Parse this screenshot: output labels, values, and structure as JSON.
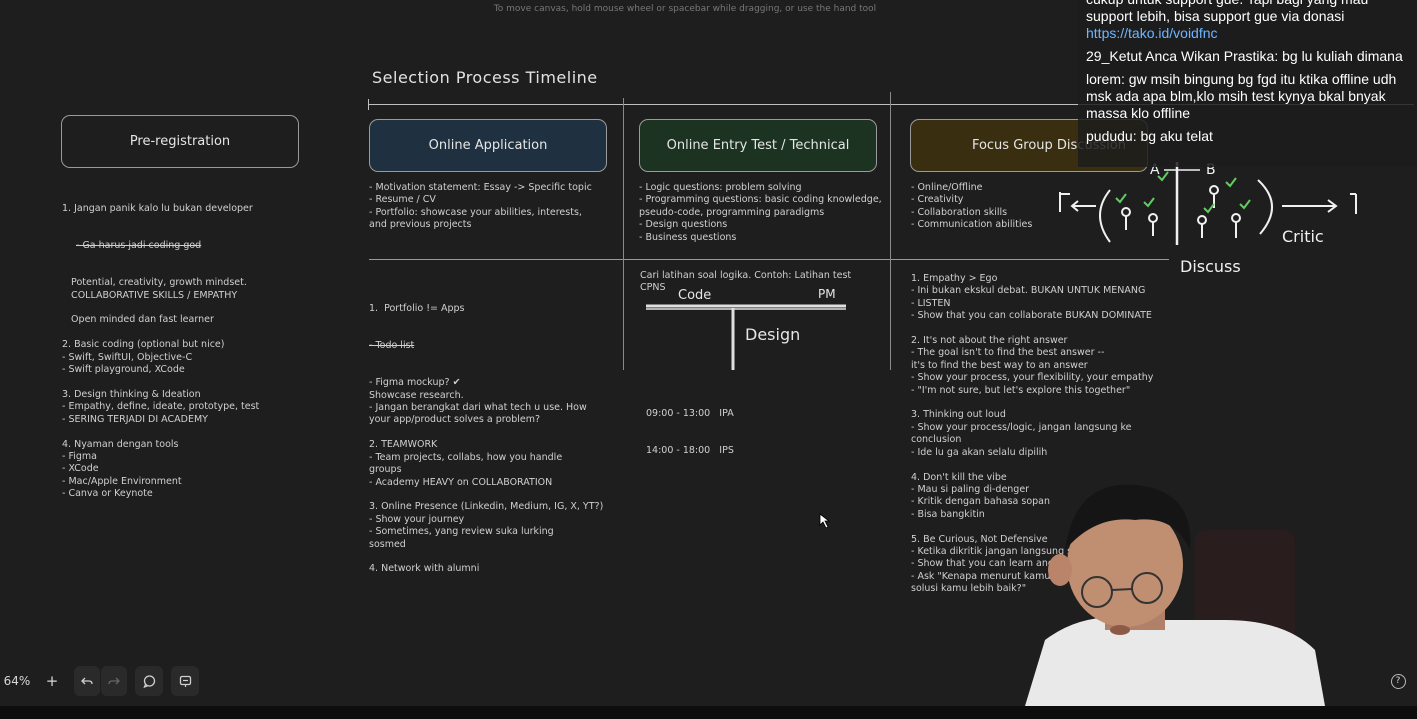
{
  "canvas_hint": "To move canvas, hold mouse wheel or spacebar while dragging, or use the hand tool",
  "board": {
    "title": "Selection Process Timeline",
    "preregistration": {
      "label": "Pre-registration",
      "notes": "1. Jangan panik kalo lu bukan developer",
      "struck": "- Ga harus jadi coding god",
      "notes2": "   Potential, creativity, growth mindset.\n   COLLABORATIVE SKILLS / EMPATHY\n\n   Open minded dan fast learner\n\n2. Basic coding (optional but nice)\n- Swift, SwiftUI, Objective-C\n- Swift playground, XCode\n\n3. Design thinking & Ideation\n- Empathy, define, ideate, prototype, test\n- SERING TERJADI DI ACADEMY\n\n4. Nyaman dengan tools\n- Figma\n- XCode\n- Mac/Apple Environment\n- Canva or Keynote"
    },
    "online_application": {
      "label": "Online Application",
      "top_notes": "- Motivation statement: Essay -> Specific topic\n- Resume / CV\n- Portfolio: showcase your abilities, interests,\nand previous projects",
      "bottom_notes_a": "1.  Portfolio != Apps",
      "bottom_struck": "- Todo list",
      "bottom_notes_b": "- Figma mockup? ✔\nShowcase research.\n- Jangan berangkat dari what tech u use. How\nyour app/product solves a problem?\n\n2. TEAMWORK\n- Team projects, collabs, how you handle\ngroups\n- Academy HEAVY on COLLABORATION\n\n3. Online Presence (Linkedin, Medium, IG, X, YT?)\n- Show your journey\n- Sometimes, yang review suka lurking\nsosmed\n\n4. Network with alumni"
    },
    "online_test": {
      "label": "Online Entry Test / Technical",
      "top_notes": "- Logic questions: problem solving\n- Programming questions: basic coding knowledge,\npseudo-code, programming paradigms\n- Design questions\n- Business questions",
      "bottom_notes": "Cari latihan soal logika. Contoh: Latihan test\nCPNS",
      "sketch_code": "Code",
      "sketch_pm": "PM",
      "sketch_design": "Design",
      "schedule": [
        {
          "time": "09:00 - 13:00",
          "subject": "IPA"
        },
        {
          "time": "14:00 - 18:00",
          "subject": "IPS"
        }
      ]
    },
    "fgd": {
      "label": "Focus Group Discussion",
      "top_notes": "- Online/Offline\n- Creativity\n- Collaboration skills\n- Communication abilities",
      "bottom_notes": "1. Empathy > Ego\n- Ini bukan ekskul debat. BUKAN UNTUK MENANG\n- LISTEN\n- Show that you can collaborate BUKAN DOMINATE\n\n2. It's not about the right answer\n- The goal isn't to find the best answer --\nit's to find the best way to an answer\n- Show your process, your flexibility, your empathy\n- \"I'm not sure, but let's explore this together\"\n\n3. Thinking out loud\n- Show your process/logic, jangan langsung ke\nconclusion\n- Ide lu ga akan selalu dipilih\n\n4. Don't kill the vibe\n- Mau si paling di-denger\n- Kritik dengan bahasa sopan\n- Bisa bangkitin\n\n5. Be Curious, Not Defensive\n- Ketika dikritik jangan langsung s\n- Show that you can learn and adap\n- Ask \"Kenapa menurut kamu,\nsolusi kamu lebih baik?\"",
      "sketch_a": "A",
      "sketch_b": "B",
      "sketch_discuss": "Discuss",
      "sketch_critic": "Critic"
    }
  },
  "chat": {
    "messages": [
      {
        "user": "",
        "text": "cukup untuk support gue. Tapi bagi yang mau support lebih, bisa support gue via donasi",
        "link": "https://tako.id/voidfnc"
      },
      {
        "user": "29_Ketut Anca Wikan Prastika:",
        "text": "bg lu kuliah dimana"
      },
      {
        "user": "lorem:",
        "text": "gw msih bingung bg fgd itu ktika offline udh msk ada apa blm,klo msih test kynya bkal bnyak massa klo offline"
      },
      {
        "user": "pududu:",
        "text": "bg aku telat"
      }
    ]
  },
  "toolbar": {
    "zoom": "64%",
    "zoom_in": "+",
    "undo_icon": "undo-icon",
    "redo_icon": "redo-icon",
    "comment_icon": "comment-icon",
    "notes_icon": "notes-icon",
    "help": "?"
  },
  "colors": {
    "background": "#1e1e1e",
    "online_application_fill": "#1f3140",
    "online_test_fill": "#1c3321",
    "fgd_fill": "#3a2e10",
    "link": "#6fb6ff"
  }
}
